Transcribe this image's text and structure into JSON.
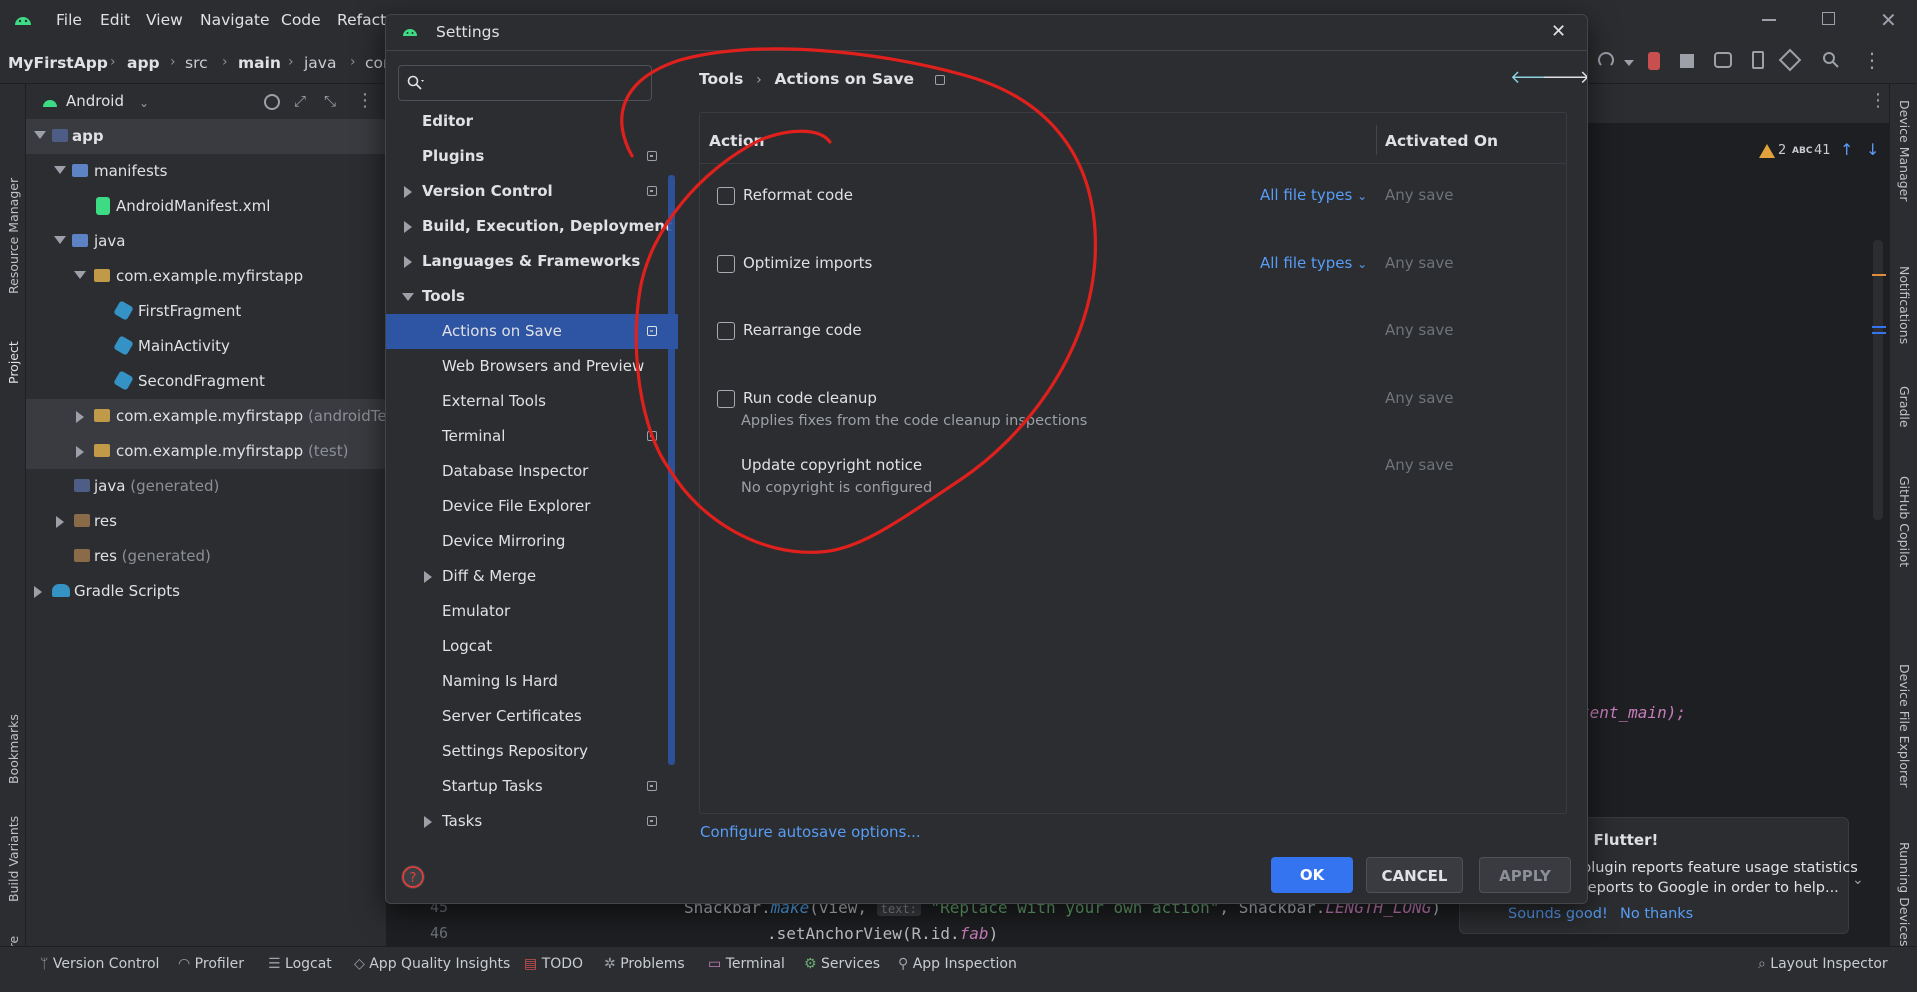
{
  "ide": {
    "menu": [
      "File",
      "Edit",
      "View",
      "Navigate",
      "Code",
      "Refactor"
    ],
    "breadcrumb": [
      "MyFirstApp",
      "app",
      "src",
      "main",
      "java",
      "com"
    ],
    "project_view": "Android",
    "tree": [
      {
        "label": "app",
        "level": 0
      },
      {
        "label": "manifests",
        "level": 1
      },
      {
        "label": "AndroidManifest.xml",
        "level": 2
      },
      {
        "label": "java",
        "level": 1
      },
      {
        "label": "com.example.myfirstapp",
        "level": 2
      },
      {
        "label": "FirstFragment",
        "level": 3
      },
      {
        "label": "MainActivity",
        "level": 3
      },
      {
        "label": "SecondFragment",
        "level": 3
      },
      {
        "label": "com.example.myfirstapp",
        "suffix": "(androidTest)",
        "level": 2
      },
      {
        "label": "com.example.myfirstapp",
        "suffix": "(test)",
        "level": 2
      },
      {
        "label": "java",
        "suffix": "(generated)",
        "level": 1
      },
      {
        "label": "res",
        "level": 1
      },
      {
        "label": "res",
        "suffix": "(generated)",
        "level": 1
      },
      {
        "label": "Gradle Scripts",
        "level": 0
      }
    ],
    "left_tools": [
      "Resource Manager",
      "Project",
      "Bookmarks",
      "Build Variants",
      "Structure"
    ],
    "right_tools": [
      "Device Manager",
      "Notifications",
      "Gradle",
      "GitHub Copilot",
      "Device File Explorer",
      "Running Devices"
    ],
    "inspection": {
      "warnings": "2",
      "typos": "41",
      "typo_label": "ABC"
    },
    "status_items": [
      "Version Control",
      "Profiler",
      "Logcat",
      "App Quality Insights",
      "TODO",
      "Problems",
      "Terminal",
      "Services",
      "App Inspection",
      "Layout Inspector"
    ],
    "code": {
      "fragment": "tent_main);",
      "line_numbers": [
        "45",
        "46"
      ],
      "line45_a": "Snackbar.",
      "line45_b": "make",
      "line45_c": "(view,",
      "line45_hint": "text:",
      "line45_d": "\"Replace with your own action\"",
      "line45_e": ", Snackbar.",
      "line45_f": "LENGTH_LONG",
      "line45_g": ")",
      "line46": ".setAnchorView(R.id.",
      "line46_b": "fab",
      "line46_c": ")"
    },
    "notification": {
      "title": "o Flutter!",
      "body_1": "plugin reports feature usage statistics",
      "body_2": "reports to Google in order to help...",
      "action_1": "Sounds good!",
      "action_2": "No thanks"
    }
  },
  "dialog": {
    "title": "Settings",
    "search_placeholder": "",
    "nav": [
      {
        "label": "Editor",
        "bold": true
      },
      {
        "label": "Plugins",
        "bold": true,
        "badge": true
      },
      {
        "label": "Version Control",
        "bold": true,
        "arrow": "right",
        "badge": true
      },
      {
        "label": "Build, Execution, Deployment",
        "bold": true,
        "arrow": "right"
      },
      {
        "label": "Languages & Frameworks",
        "bold": true,
        "arrow": "right"
      },
      {
        "label": "Tools",
        "bold": true,
        "arrow": "down"
      },
      {
        "label": "Actions on Save",
        "selected": true,
        "badge": true
      },
      {
        "label": "Web Browsers and Preview"
      },
      {
        "label": "External Tools"
      },
      {
        "label": "Terminal",
        "badge": true
      },
      {
        "label": "Database Inspector"
      },
      {
        "label": "Device File Explorer"
      },
      {
        "label": "Device Mirroring"
      },
      {
        "label": "Diff & Merge",
        "arrow": "right"
      },
      {
        "label": "Emulator"
      },
      {
        "label": "Logcat"
      },
      {
        "label": "Naming Is Hard"
      },
      {
        "label": "Server Certificates"
      },
      {
        "label": "Settings Repository"
      },
      {
        "label": "Startup Tasks",
        "badge": true
      },
      {
        "label": "Tasks",
        "arrow": "right",
        "badge": true
      }
    ],
    "breadcrumb": {
      "parent": "Tools",
      "current": "Actions on Save"
    },
    "table": {
      "header_action": "Action",
      "header_activated": "Activated On",
      "rows": [
        {
          "label": "Reformat code",
          "checked": false,
          "file_types": "All file types",
          "activated": "Any save"
        },
        {
          "label": "Optimize imports",
          "checked": false,
          "file_types": "All file types",
          "activated": "Any save"
        },
        {
          "label": "Rearrange code",
          "checked": false,
          "activated": "Any save"
        },
        {
          "label": "Run code cleanup",
          "checked": false,
          "description": "Applies fixes from the code cleanup inspections",
          "activated": "Any save"
        },
        {
          "label": "Update copyright notice",
          "description": "No copyright is configured",
          "activated": "Any save"
        }
      ]
    },
    "configure_link": "Configure autosave options...",
    "buttons": {
      "ok": "OK",
      "cancel": "CANCEL",
      "apply": "APPLY"
    }
  },
  "colors": {
    "accent": "#3574f0",
    "link": "#589df6",
    "selection": "#2e55a3",
    "annotation": "#e0201c"
  }
}
